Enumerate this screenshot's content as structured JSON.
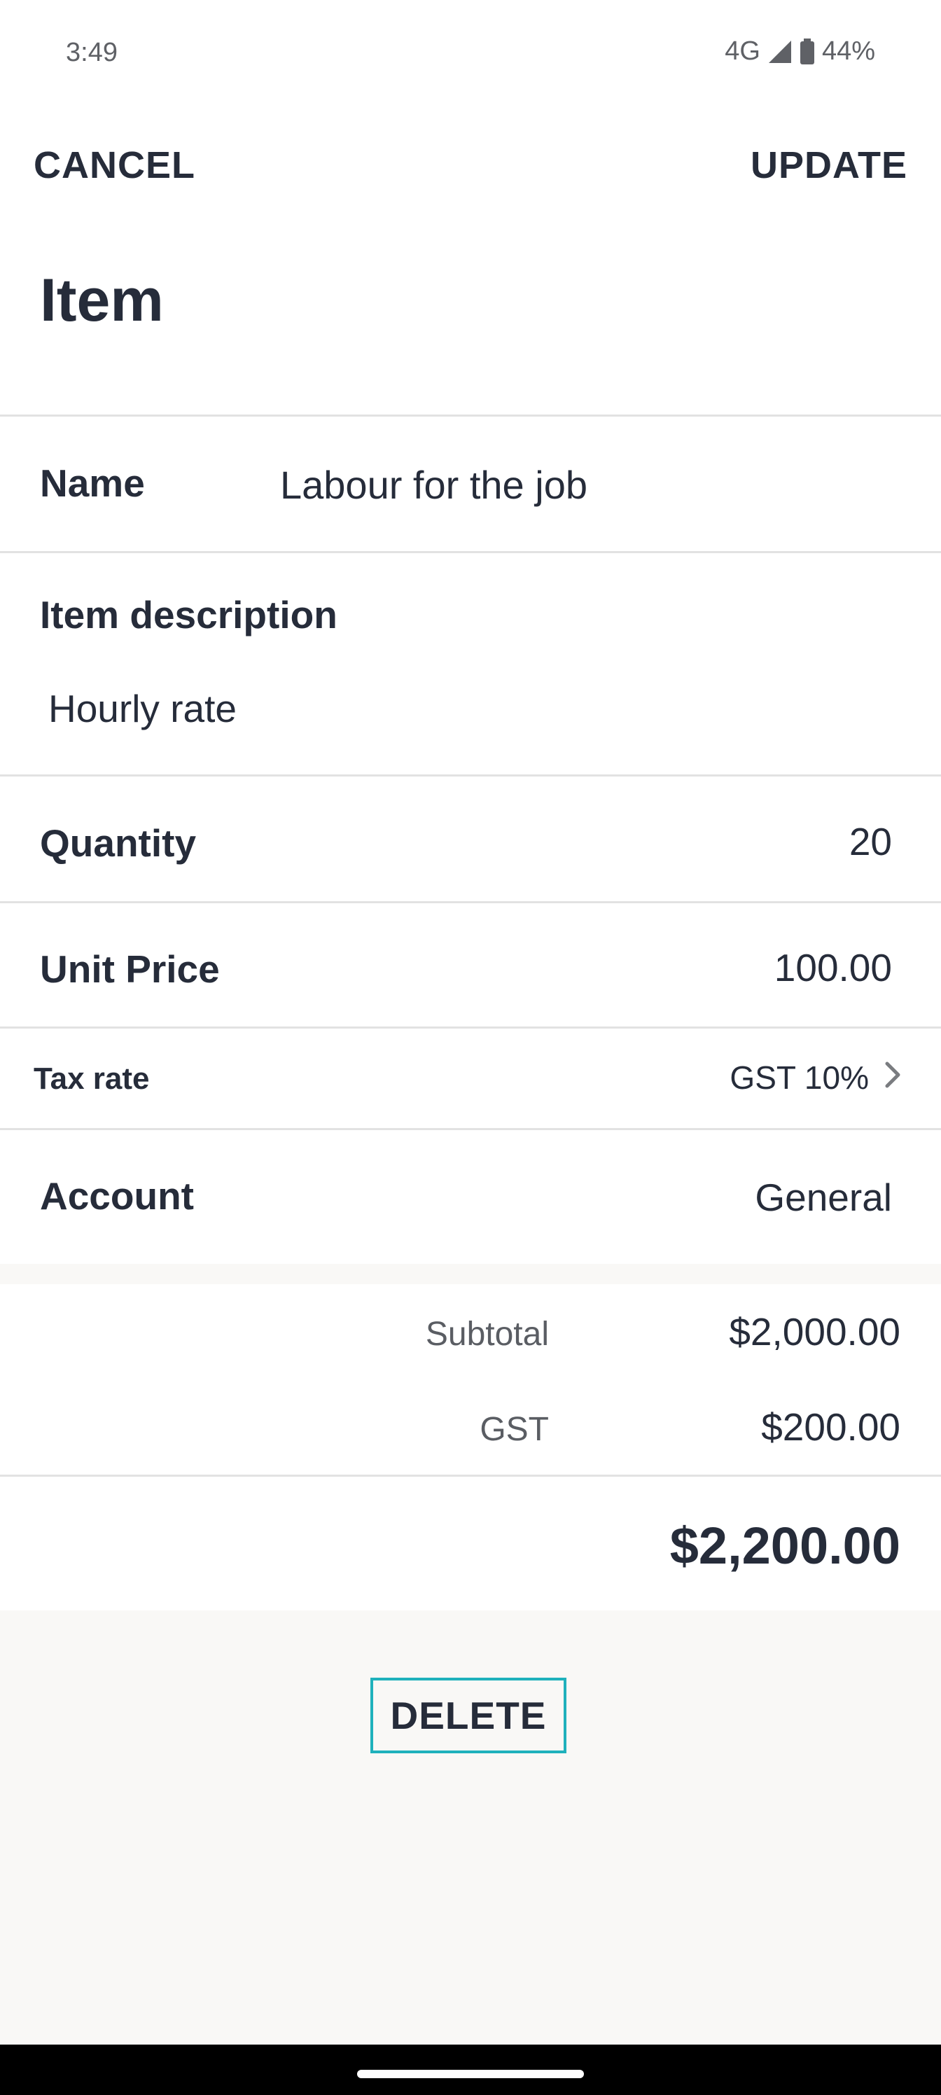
{
  "status_bar": {
    "time": "3:49",
    "network": "4G",
    "battery": "44%"
  },
  "header": {
    "cancel_label": "CANCEL",
    "update_label": "UPDATE",
    "title": "Item"
  },
  "form": {
    "name_label": "Name",
    "name_value": "Labour for the job",
    "description_label": "Item description",
    "description_value": "Hourly rate",
    "quantity_label": "Quantity",
    "quantity_value": "20",
    "unit_price_label": "Unit Price",
    "unit_price_value": "100.00",
    "tax_rate_label": "Tax rate",
    "tax_rate_value": "GST 10%",
    "account_label": "Account",
    "account_value": "General"
  },
  "summary": {
    "subtotal_label": "Subtotal",
    "subtotal_value": "$2,000.00",
    "gst_label": "GST",
    "gst_value": "$200.00",
    "total_value": "$2,200.00"
  },
  "actions": {
    "delete_label": "DELETE"
  },
  "colors": {
    "text": "#262c3a",
    "accent_border": "#1fb1bc",
    "background": "#f9f8f6"
  }
}
